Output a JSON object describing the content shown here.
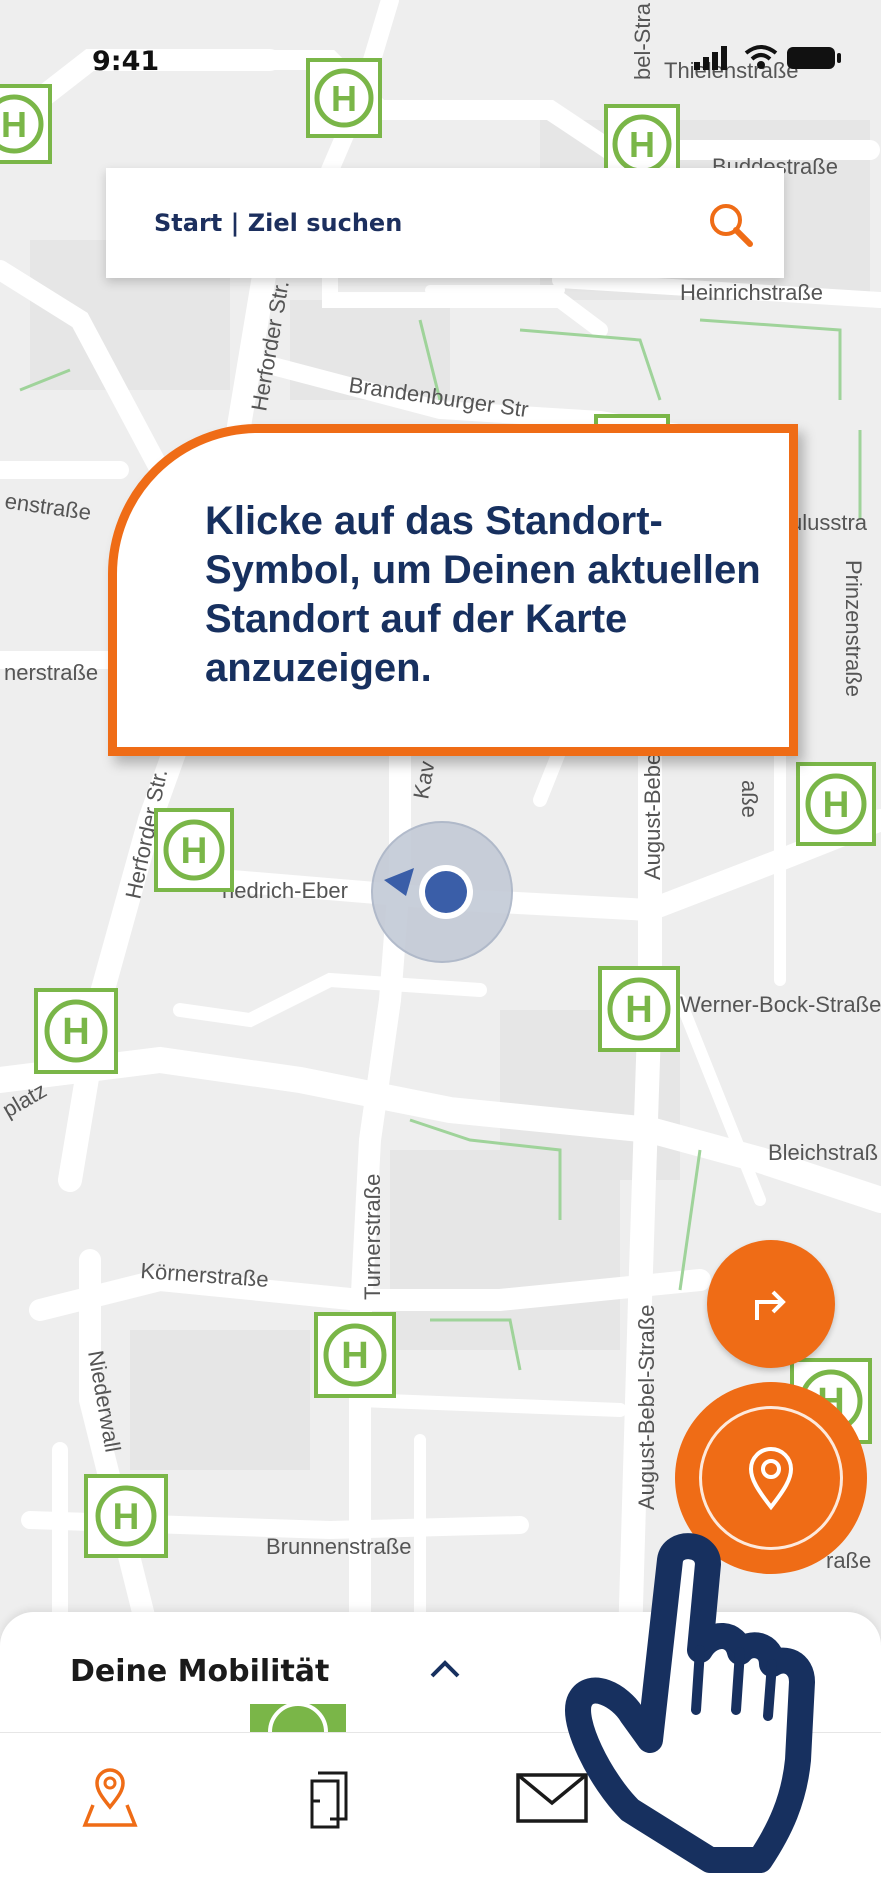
{
  "status": {
    "time": "9:41"
  },
  "search": {
    "label": "Start | Ziel suchen"
  },
  "tooltip": {
    "text": "Klicke auf das Standort-Symbol, um Deinen aktuellen Standort auf der Karte anzuzeigen."
  },
  "map": {
    "streets": [
      {
        "name": "Thielenstraße"
      },
      {
        "name": "Buddestraße"
      },
      {
        "name": "Heinrichstraße"
      },
      {
        "name": "Brandenburger Str"
      },
      {
        "name": "Herforder Str."
      },
      {
        "name": "enstraße"
      },
      {
        "name": "ulusstra"
      },
      {
        "name": "Prinzenstraße"
      },
      {
        "name": "nerstraße"
      },
      {
        "name": "Herforder Str."
      },
      {
        "name": "Kav"
      },
      {
        "name": "August-Bebe"
      },
      {
        "name": "aße"
      },
      {
        "name": "riedrich-Eber"
      },
      {
        "name": "Werner-Bock-Straße"
      },
      {
        "name": "platz"
      },
      {
        "name": "Bleichstraß"
      },
      {
        "name": "Turnerstraße"
      },
      {
        "name": "Körnerstraße"
      },
      {
        "name": "Niederwall"
      },
      {
        "name": "August-Bebel-Straße"
      },
      {
        "name": "Brunnenstraße"
      },
      {
        "name": "raße"
      },
      {
        "name": "bel-Stra"
      }
    ],
    "stop_symbol": "H"
  },
  "sheet": {
    "title": "Deine Mobilität"
  },
  "nav": {
    "items": [
      "map",
      "tickets",
      "messages",
      "profile"
    ]
  },
  "colors": {
    "accent": "#ef6c16",
    "navy": "#17305f",
    "green": "#7ab648",
    "map_bg": "#eeeeee"
  }
}
